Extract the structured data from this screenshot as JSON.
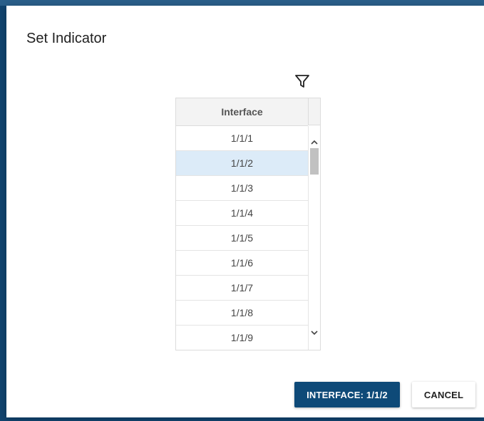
{
  "dialog": {
    "title": "Set Indicator"
  },
  "toolbar": {
    "filter_icon": "filter-icon"
  },
  "grid": {
    "columns": [
      "Interface"
    ],
    "rows": [
      "1/1/1",
      "1/1/2",
      "1/1/3",
      "1/1/4",
      "1/1/5",
      "1/1/6",
      "1/1/7",
      "1/1/8",
      "1/1/9"
    ],
    "selected": "1/1/2"
  },
  "actions": {
    "confirm_label": "INTERFACE: 1/1/2",
    "cancel_label": "CANCEL"
  },
  "colors": {
    "primary": "#0e4a78",
    "selected_row": "#dcebf8",
    "header_bg": "#f3f3f3"
  }
}
